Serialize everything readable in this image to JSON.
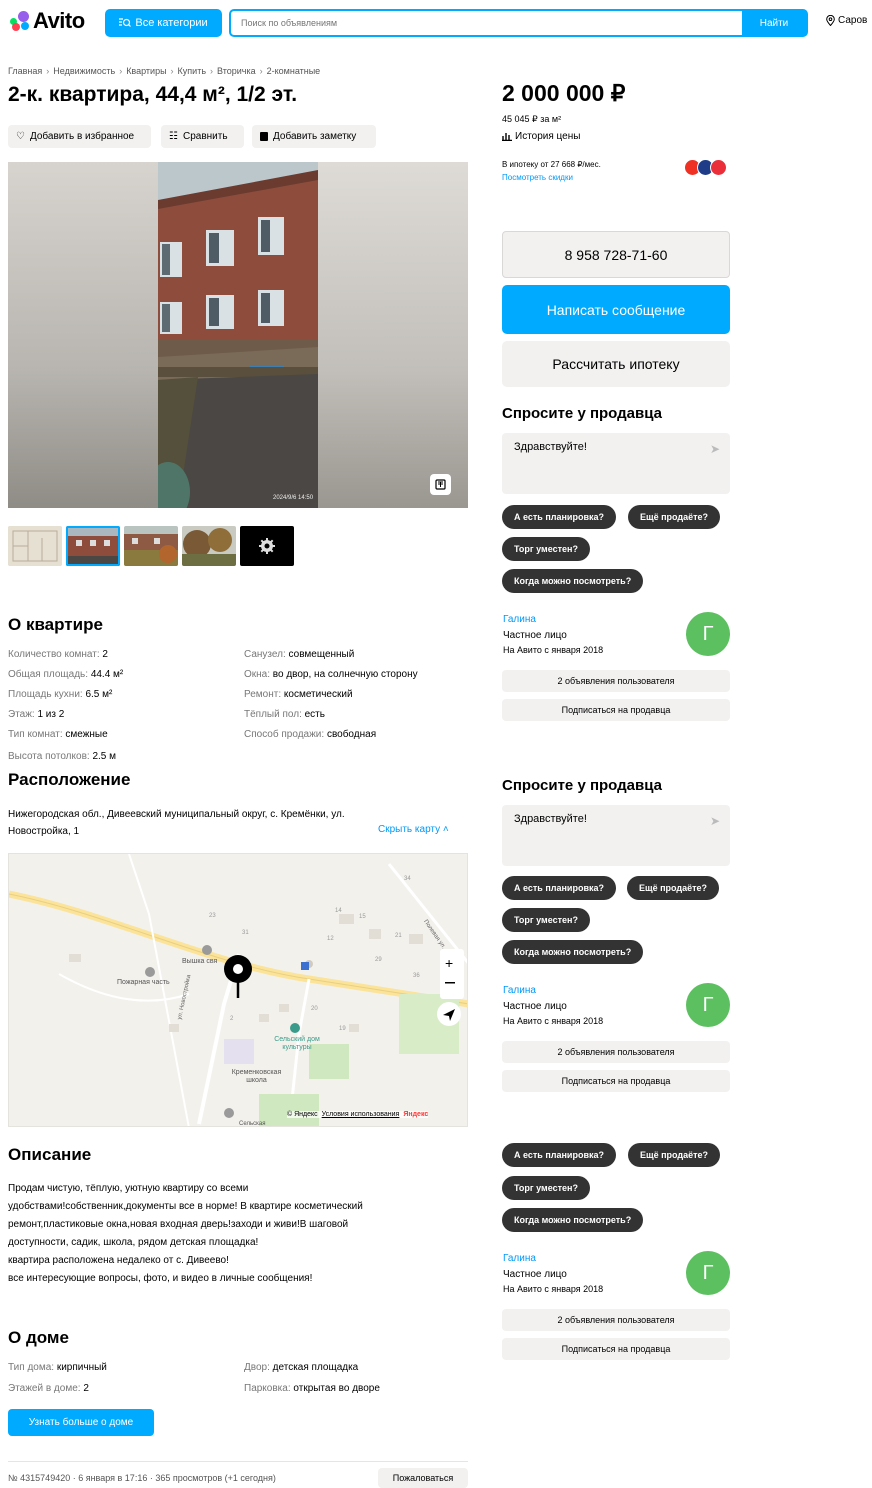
{
  "header": {
    "logo_text": "Avito",
    "categories_label": "Все категории",
    "search_placeholder": "Поиск по объявлениям",
    "search_button": "Найти",
    "city": "Саров"
  },
  "breadcrumbs": [
    "Главная",
    "Недвижимость",
    "Квартиры",
    "Купить",
    "Вторичка",
    "2-комнатные"
  ],
  "title": "2-к. квартира, 44,4 м², 1/2 эт.",
  "actions": {
    "favorite": "Добавить в избранное",
    "compare": "Сравнить",
    "note": "Добавить заметку"
  },
  "gallery": {
    "photo_stamp": "2024/9/6 14:50",
    "thumb_count": 5
  },
  "price": {
    "value": "2 000 000 ₽",
    "per_m2": "45 045 ₽ за м²",
    "history": "История цены",
    "mortgage": "В ипотеку от 27 668 ₽/мес.",
    "discounts": "Посмотреть скидки"
  },
  "contact": {
    "phone": "8 958 728-71-60",
    "message": "Написать сообщение",
    "mortgage_calc": "Рассчитать ипотеку"
  },
  "ask": {
    "heading": "Спросите у продавца",
    "greeting": "Здравствуйте!",
    "q1": "А есть планировка?",
    "q2": "Ещё продаёте?",
    "q3": "Торг уместен?",
    "q4": "Когда можно посмотреть?"
  },
  "seller": {
    "name": "Галина",
    "type": "Частное лицо",
    "since": "На Авито с января 2018",
    "initial": "Г",
    "ads": "2 объявления пользователя",
    "subscribe": "Подписаться на продавца"
  },
  "about_flat": {
    "heading": "О квартире",
    "left": [
      {
        "k": "Количество комнат: ",
        "v": "2"
      },
      {
        "k": "Общая площадь: ",
        "v": "44.4 м²"
      },
      {
        "k": "Площадь кухни: ",
        "v": "6.5 м²"
      },
      {
        "k": "Этаж: ",
        "v": "1 из 2"
      },
      {
        "k": "Тип комнат: ",
        "v": "смежные"
      },
      {
        "k": "Высота потолков: ",
        "v": "2.5 м"
      }
    ],
    "right": [
      {
        "k": "Санузел: ",
        "v": "совмещенный"
      },
      {
        "k": "Окна: ",
        "v": "во двор, на солнечную сторону"
      },
      {
        "k": "Ремонт: ",
        "v": "косметический"
      },
      {
        "k": "Тёплый пол: ",
        "v": "есть"
      },
      {
        "k": "Способ продажи: ",
        "v": "свободная"
      }
    ]
  },
  "location": {
    "heading": "Расположение",
    "address": "Нижегородская обл., Дивеевский муниципальный округ, с. Кремёнки, ул. Новостройка, 1",
    "hide_map": "Скрыть карту",
    "map_labels": {
      "fire": "Пожарная часть",
      "tower": "Вышка свя",
      "club": "Сельский дом культуры",
      "school": "Кременковская школа",
      "street1": "ул. Новостройка",
      "street2": "Полевая ул.",
      "copyright": "© Яндекс",
      "terms": "Условия использования",
      "brand": "Яндекс",
      "rural": "Сельская"
    }
  },
  "description": {
    "heading": "Описание",
    "lines": [
      "Продам чистую, тёплую, уютную квартиру со всеми",
      "удобствами!собственник,документы все в норме! В квартире косметический",
      "ремонт,пластиковые окна,новая входная дверь!заходи и живи!В шаговой",
      "доступности, садик, школа, рядом детская площадка!",
      "квартира расположена недалеко от с. Дивеево!",
      "все интересующие вопросы, фото, и видео в личные сообщения!"
    ]
  },
  "house": {
    "heading": "О доме",
    "type_k": "Тип дома: ",
    "type_v": "кирпичный",
    "floors_k": "Этажей в доме: ",
    "floors_v": "2",
    "yard_k": "Двор: ",
    "yard_v": "детская площадка",
    "parking_k": "Парковка: ",
    "parking_v": "открытая во дворе",
    "more": "Узнать больше о доме"
  },
  "footer": {
    "meta": "№ 4315749420 · 6 января в 17:16 · 365 просмотров (+1 сегодня)",
    "report": "Пожаловаться"
  }
}
